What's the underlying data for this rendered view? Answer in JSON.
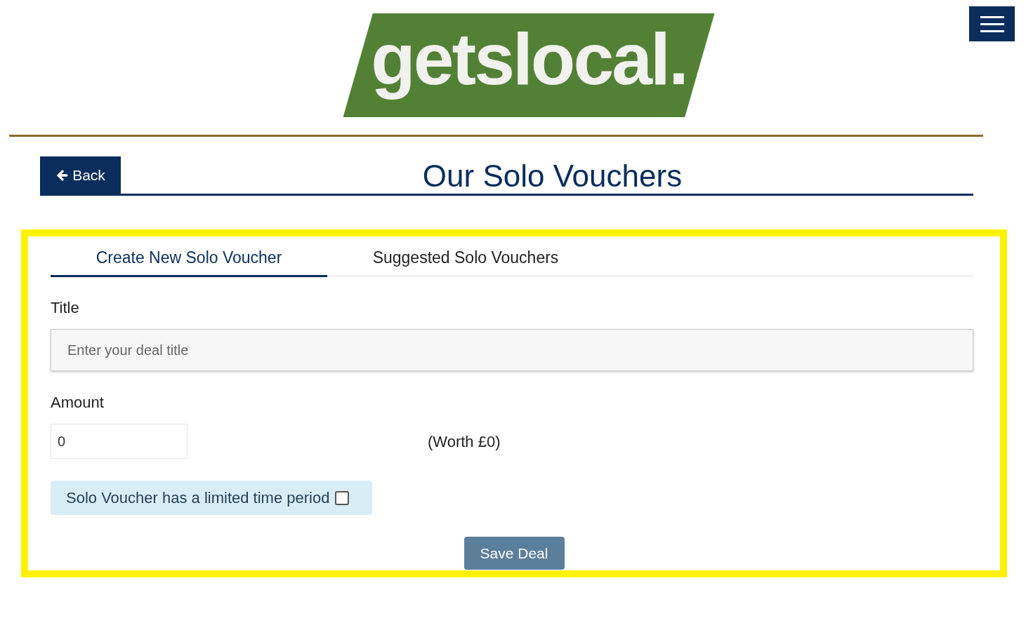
{
  "header": {
    "logo": "getslocal."
  },
  "page": {
    "back_button": "Back",
    "title": "Our Solo Vouchers"
  },
  "tabs": [
    {
      "label": "Create New Solo Voucher",
      "selected": true
    },
    {
      "label": "Suggested Solo Vouchers",
      "selected": false
    }
  ],
  "form": {
    "title_label": "Title",
    "title_field": {
      "placeholder": "Enter your deal title"
    },
    "amount_label": "Amount",
    "amount_field": {
      "value": "0"
    },
    "worth": "(Worth £0)",
    "limited_time": {
      "label": "Solo Voucher has a limited time period",
      "checked": false
    },
    "save_button": "Save Deal"
  }
}
